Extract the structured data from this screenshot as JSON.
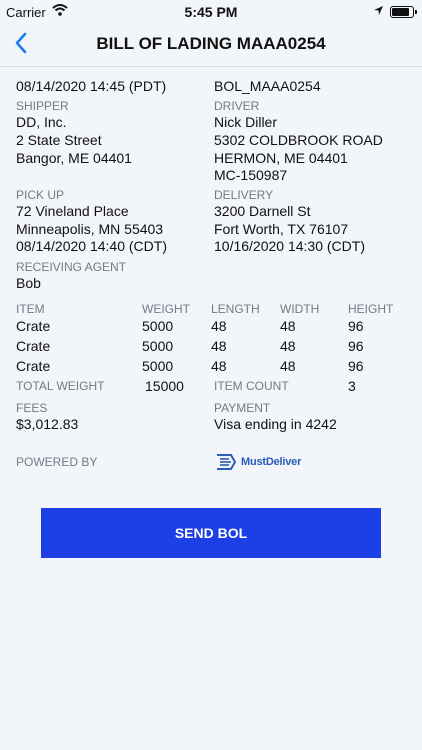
{
  "status_bar": {
    "carrier": "Carrier",
    "time": "5:45 PM"
  },
  "nav": {
    "title": "BILL OF LADING MAAA0254"
  },
  "header": {
    "datetime": "08/14/2020 14:45 (PDT)",
    "bol_number": "BOL_MAAA0254"
  },
  "shipper": {
    "label": "SHIPPER",
    "name": "DD, Inc.",
    "street": "2 State Street",
    "city": "Bangor, ME 04401"
  },
  "driver": {
    "label": "DRIVER",
    "name": "Nick Diller",
    "street": "5302 COLDBROOK ROAD",
    "city": "HERMON, ME 04401",
    "license": "MC-150987"
  },
  "pickup": {
    "label": "PICK UP",
    "street": "72 Vineland Place",
    "city": "Minneapolis, MN 55403",
    "datetime": "08/14/2020 14:40 (CDT)"
  },
  "delivery": {
    "label": "DELIVERY",
    "street": "3200 Darnell St",
    "city": "Fort Worth, TX 76107",
    "datetime": "10/16/2020 14:30 (CDT)"
  },
  "receiving_agent": {
    "label": "RECEIVING AGENT",
    "name": "Bob"
  },
  "items": {
    "headers": [
      "ITEM",
      "WEIGHT",
      "LENGTH",
      "WIDTH",
      "HEIGHT"
    ],
    "rows": [
      [
        "Crate",
        "5000",
        "48",
        "48",
        "96"
      ],
      [
        "Crate",
        "5000",
        "48",
        "48",
        "96"
      ],
      [
        "Crate",
        "5000",
        "48",
        "48",
        "96"
      ]
    ]
  },
  "totals": {
    "weight_label": "TOTAL WEIGHT",
    "weight": "15000",
    "count_label": "ITEM COUNT",
    "count": "3"
  },
  "fees": {
    "label": "FEES",
    "value": "$3,012.83"
  },
  "payment": {
    "label": "PAYMENT",
    "value": "Visa ending in 4242"
  },
  "powered_by": {
    "label": "POWERED BY",
    "brand": "MustDeliver"
  },
  "actions": {
    "send_label": "SEND BOL"
  },
  "colors": {
    "accent": "#1c3fe6",
    "back_icon": "#1a7cf5",
    "label_gray": "#737b85",
    "background": "#f2f5f9"
  }
}
